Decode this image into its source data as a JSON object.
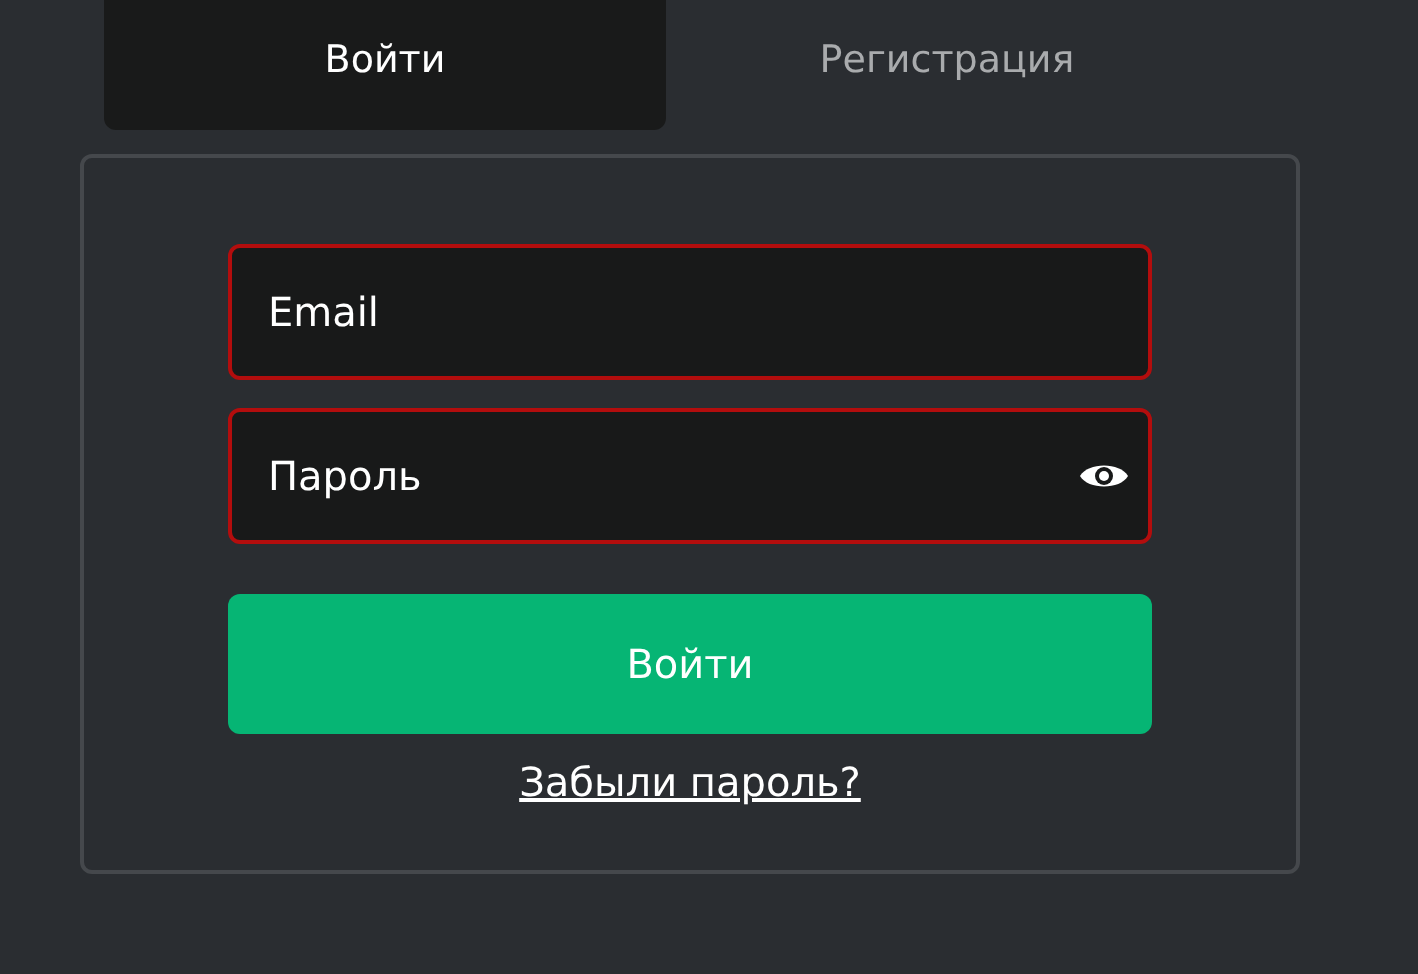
{
  "tabs": [
    {
      "label": "Войти",
      "selected": true
    },
    {
      "label": "Регистрация",
      "selected": false
    }
  ],
  "form": {
    "fields": [
      {
        "kind": "email",
        "placeholder": "Email",
        "invalid": true
      },
      {
        "kind": "password",
        "placeholder": "Пароль",
        "invalid": true
      }
    ],
    "submit": "Войти",
    "forgot_link": "Забыли пароль?"
  }
}
